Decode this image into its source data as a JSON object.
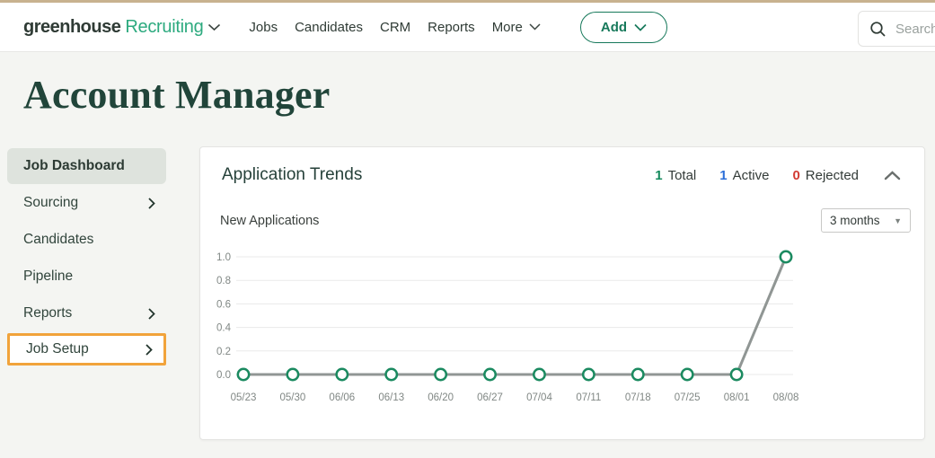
{
  "brand": {
    "name": "greenhouse",
    "product": "Recruiting"
  },
  "nav": {
    "items": [
      "Jobs",
      "Candidates",
      "CRM",
      "Reports",
      "More"
    ],
    "add_label": "Add",
    "search_placeholder": "Search"
  },
  "page": {
    "title": "Account Manager"
  },
  "sidebar": {
    "items": [
      {
        "label": "Job Dashboard"
      },
      {
        "label": "Sourcing"
      },
      {
        "label": "Candidates"
      },
      {
        "label": "Pipeline"
      },
      {
        "label": "Reports"
      },
      {
        "label": "Job Setup"
      }
    ],
    "highlight_color": "#f1a33b",
    "active_bg": "#dee3dd"
  },
  "panel": {
    "title": "Application Trends",
    "stats": [
      {
        "value": "1",
        "label": "Total",
        "color": "#158a5d"
      },
      {
        "value": "1",
        "label": "Active",
        "color": "#2c6fd8"
      },
      {
        "value": "0",
        "label": "Rejected",
        "color": "#d23b33"
      }
    ],
    "subtitle": "New Applications",
    "range_selected": "3 months"
  },
  "chart_data": {
    "type": "line",
    "title": "New Applications",
    "x": [
      "05/23",
      "05/30",
      "06/06",
      "06/13",
      "06/20",
      "06/27",
      "07/04",
      "07/11",
      "07/18",
      "07/25",
      "08/01",
      "08/08"
    ],
    "series": [
      {
        "name": "New Applications",
        "values": [
          0,
          0,
          0,
          0,
          0,
          0,
          0,
          0,
          0,
          0,
          0,
          1
        ]
      }
    ],
    "ylim": [
      0,
      1.0
    ],
    "yticks": [
      "1.0",
      "0.8",
      "0.6",
      "0.4",
      "0.2",
      "0.0"
    ],
    "grid": true,
    "legend": "none",
    "line_color": "#909694",
    "marker_color": "#1b8a60"
  }
}
